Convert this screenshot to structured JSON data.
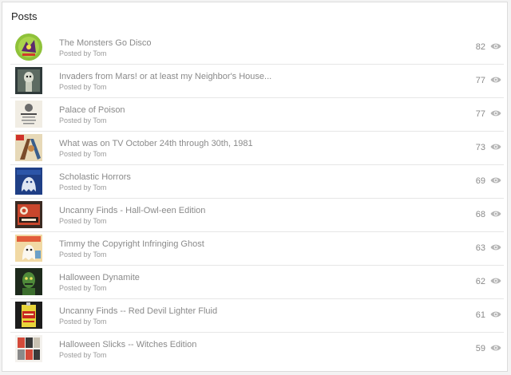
{
  "card": {
    "title": "Posts"
  },
  "posts": [
    {
      "title": "The Monsters Go Disco",
      "meta": "Posted by Tom",
      "views": "82",
      "thumb": "disco-record-thumbnail"
    },
    {
      "title": "Invaders from Mars! or at least my Neighbor's House...",
      "meta": "Posted by Tom",
      "views": "77",
      "thumb": "alien-photo-thumbnail"
    },
    {
      "title": "Palace of Poison",
      "meta": "Posted by Tom",
      "views": "77",
      "thumb": "poster-thumbnail"
    },
    {
      "title": "What was on TV October 24th through 30th, 1981",
      "meta": "Posted by Tom",
      "views": "73",
      "thumb": "tv-guide-thumbnail"
    },
    {
      "title": "Scholastic Horrors",
      "meta": "Posted by Tom",
      "views": "69",
      "thumb": "ghost-stories-book-thumbnail"
    },
    {
      "title": "Uncanny Finds - Hall-Owl-een Edition",
      "meta": "Posted by Tom",
      "views": "68",
      "thumb": "cloves-package-thumbnail"
    },
    {
      "title": "Timmy the Copyright Infringing Ghost",
      "meta": "Posted by Tom",
      "views": "63",
      "thumb": "comic-cover-thumbnail"
    },
    {
      "title": "Halloween Dynamite",
      "meta": "Posted by Tom",
      "views": "62",
      "thumb": "monster-art-thumbnail"
    },
    {
      "title": "Uncanny Finds -- Red Devil Lighter Fluid",
      "meta": "Posted by Tom",
      "views": "61",
      "thumb": "lighter-fluid-can-thumbnail"
    },
    {
      "title": "Halloween Slicks -- Witches Edition",
      "meta": "Posted by Tom",
      "views": "59",
      "thumb": "costume-catalog-thumbnail"
    }
  ],
  "icons": {
    "views": "eye-icon"
  },
  "colors": {
    "text_muted": "#8a8a8a",
    "divider": "#e6e6e6",
    "icon": "#b5b5b5"
  }
}
